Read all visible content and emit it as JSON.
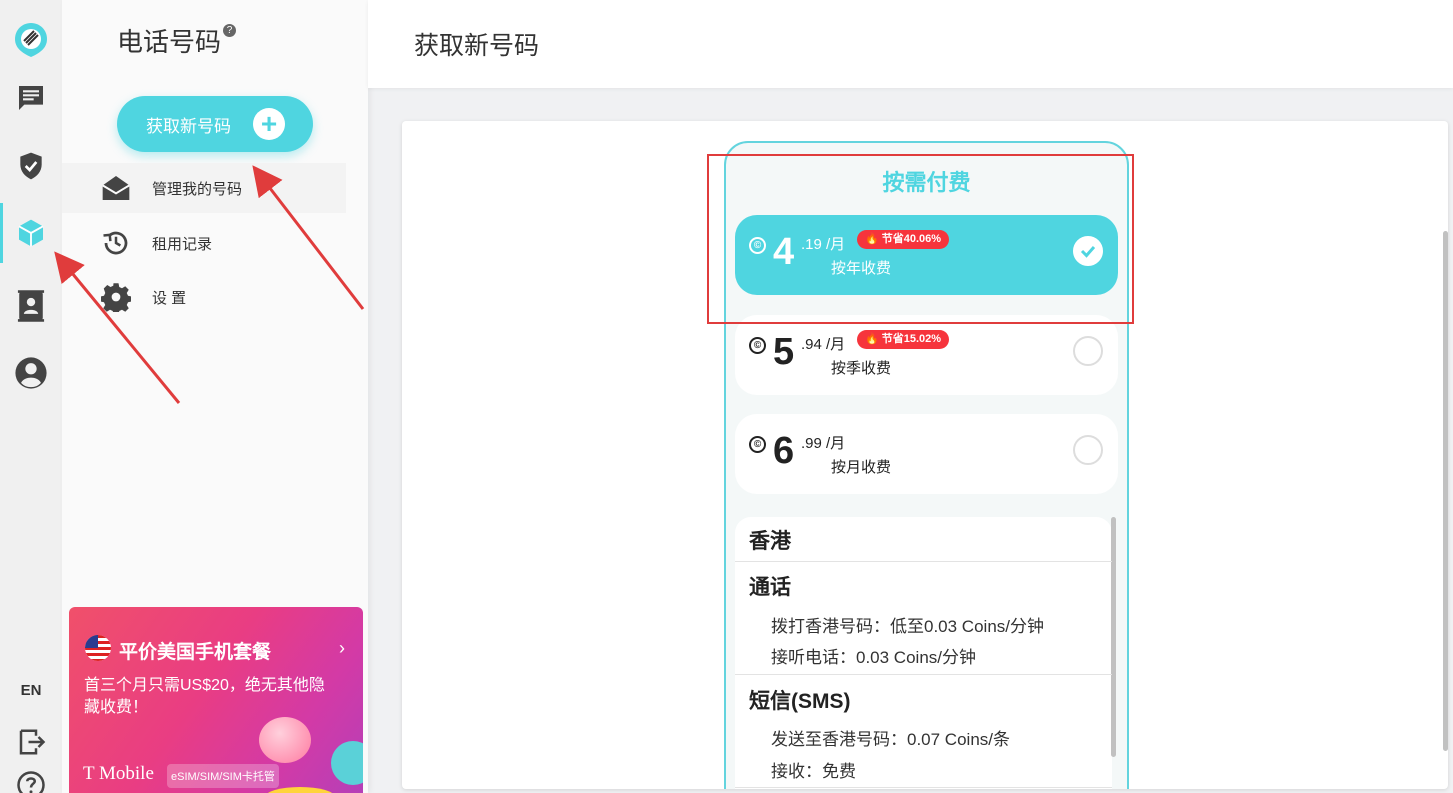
{
  "rail": {
    "lang": "EN"
  },
  "sidebar": {
    "title": "电话号码",
    "help": "?",
    "get_button": "获取新号码",
    "items": [
      {
        "label": "管理我的号码"
      },
      {
        "label": "租用记录"
      },
      {
        "label": "设 置"
      }
    ]
  },
  "promo": {
    "title": "平价美国手机套餐",
    "arrow": "›",
    "desc": "首三个月只需US$20，绝无其他隐藏收费！",
    "brand": "T Mobile",
    "tag": "eSIM/SIM/SIM卡托管"
  },
  "header": {
    "title": "获取新号码"
  },
  "phone": {
    "title": "按需付费",
    "plans": [
      {
        "int": "4",
        "dec": ".19 /月",
        "badge": "节省40.06%",
        "label": "按年收费",
        "selected": true
      },
      {
        "int": "5",
        "dec": ".94 /月",
        "badge": "节省15.02%",
        "label": "按季收费",
        "selected": false
      },
      {
        "int": "6",
        "dec": ".99 /月",
        "badge": "",
        "label": "按月收费",
        "selected": false
      }
    ],
    "coin_symbol": "©",
    "info": {
      "region": "香港",
      "call_heading": "通话",
      "call_out": "拨打香港号码：低至0.03 Coins/分钟",
      "call_in": "接听电话：0.03 Coins/分钟",
      "sms_heading": "短信(SMS)",
      "sms_out": "发送至香港号码：0.07 Coins/条",
      "sms_in": "接收：免费"
    }
  },
  "colors": {
    "accent": "#4fd5e0",
    "badge": "#f6343c",
    "annotation": "#e03c3c"
  }
}
